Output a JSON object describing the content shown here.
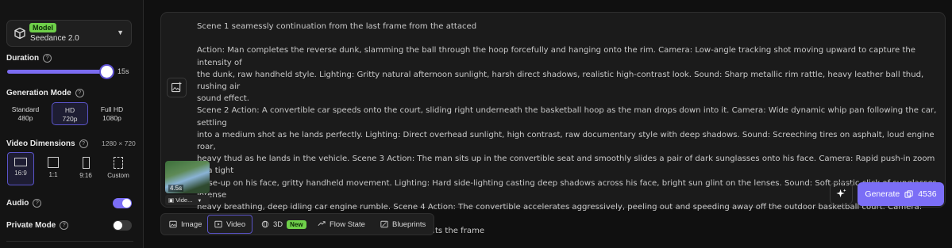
{
  "sidebar": {
    "model": {
      "tag": "Model",
      "name": "Seedance 2.0"
    },
    "duration": {
      "label": "Duration",
      "value": "15s",
      "level": 1.0
    },
    "generation_mode": {
      "label": "Generation Mode",
      "options": [
        {
          "name": "Standard",
          "res": "480p",
          "active": false
        },
        {
          "name": "HD",
          "res": "720p",
          "active": true
        },
        {
          "name": "Full HD",
          "res": "1080p",
          "active": false
        }
      ]
    },
    "video_dimensions": {
      "label": "Video Dimensions",
      "value": "1280 × 720",
      "options": [
        {
          "label": "16:9",
          "active": true
        },
        {
          "label": "1:1",
          "active": false
        },
        {
          "label": "9:16",
          "active": false
        },
        {
          "label": "Custom",
          "active": false
        }
      ]
    },
    "audio": {
      "label": "Audio",
      "on": true
    },
    "private_mode": {
      "label": "Private Mode",
      "on": false
    }
  },
  "prompt": {
    "text": "Scene 1 seamessly continuation from the last frame from the attaced\n\nAction: Man completes the reverse dunk, slamming the ball through the hoop forcefully and hanging onto the rim. Camera: Low-angle tracking shot moving upward to capture the intensity of\nthe dunk, raw handheld style. Lighting: Gritty natural afternoon sunlight, harsh direct shadows, realistic high-contrast look. Sound: Sharp metallic rim rattle, heavy leather ball thud, rushing air\nsound effect.\nScene 2 Action: A convertible car speeds onto the court, sliding right underneath the basketball hoop as the man drops down into it. Camera: Wide dynamic whip pan following the car, settling\ninto a medium shot as he lands perfectly. Lighting: Direct overhead sunlight, high contrast, raw documentary style with deep shadows. Sound: Screeching tires on asphalt, loud engine roar,\nheavy thud as he lands in the vehicle. Scene 3 Action: The man sits up in the convertible seat and smoothly slides a pair of dark sunglasses onto his face. Camera: Rapid push-in zoom to a tight\nclose-up on his face, gritty handheld movement. Lighting: Hard side-lighting casting deep shadows across his face, bright sun glint on the lenses. Sound: Soft plastic click of sunglasses, intense\nheavy breathing, deep idling car engine rumble. Scene 4 Action: The convertible accelerates aggressively, peeling out and speeding away off the outdoor basketball court. Camera: Tracking shot\nfrom behind the vehicle, rapidly pulling away as the car exits the frame",
    "attachment": {
      "duration": "4.5s",
      "label": "Vide..."
    },
    "generate_label": "Generate",
    "credits": "4536"
  },
  "tabs": [
    {
      "label": "Image",
      "icon": "image-icon",
      "active": false
    },
    {
      "label": "Video",
      "icon": "play-icon",
      "active": true
    },
    {
      "label": "3D",
      "icon": "cube-icon",
      "active": false,
      "badge": "New"
    },
    {
      "label": "Flow State",
      "icon": "flow-icon",
      "active": false
    },
    {
      "label": "Blueprints",
      "icon": "blueprint-icon",
      "active": false
    }
  ],
  "colors": {
    "accent": "#7b6ef6",
    "badge_green": "#6fd04a",
    "background": "#101010"
  }
}
